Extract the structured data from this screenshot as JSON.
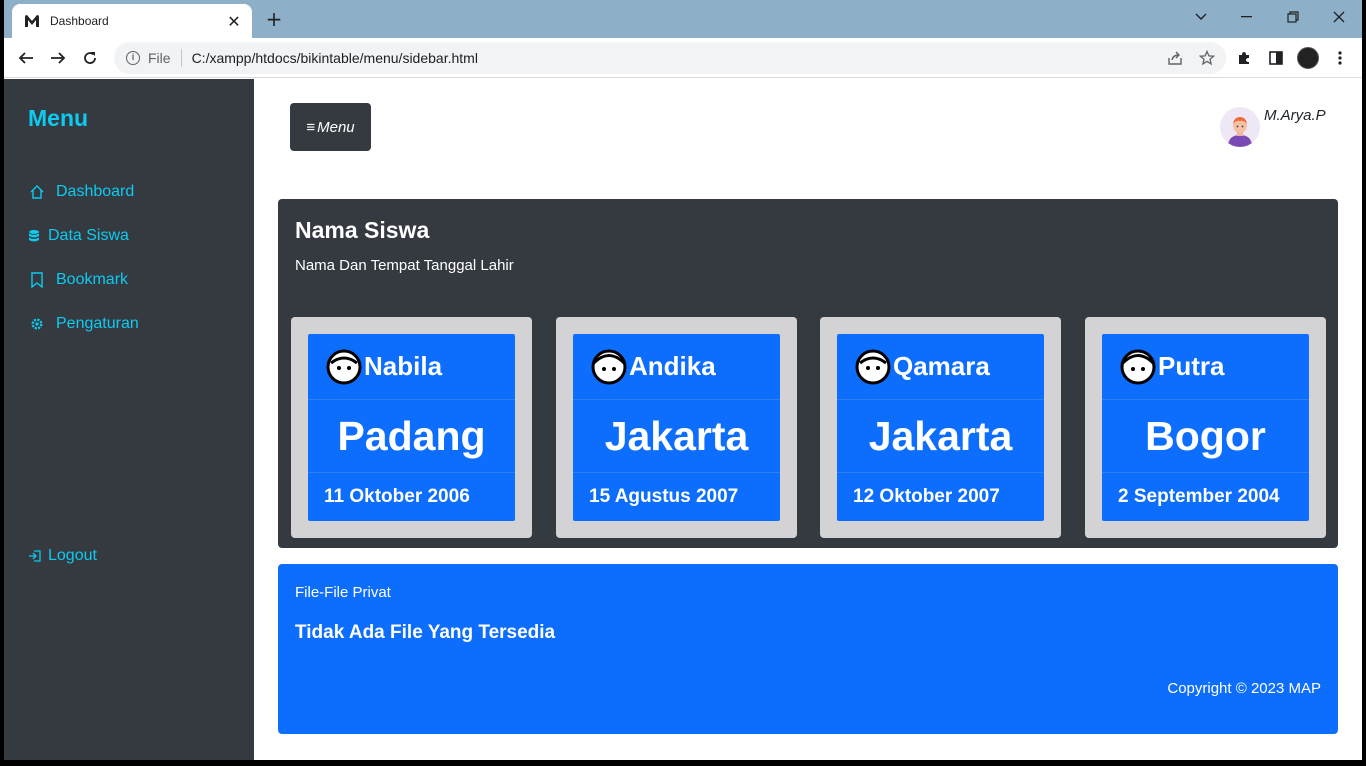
{
  "browser": {
    "tab_title": "Dashboard",
    "scheme": "File",
    "url": "C:/xampp/htdocs/bikintable/menu/sidebar.html"
  },
  "sidebar": {
    "brand": "Menu",
    "items": [
      {
        "label": "Dashboard",
        "icon": "home-icon"
      },
      {
        "label": "Data Siswa",
        "icon": "database-icon"
      },
      {
        "label": "Bookmark",
        "icon": "bookmark-icon"
      },
      {
        "label": "Pengaturan",
        "icon": "gear-icon"
      }
    ],
    "logout": "Logout"
  },
  "header": {
    "menu_button": "Menu",
    "user_name": "M.Arya.P"
  },
  "students_panel": {
    "title": "Nama Siswa",
    "subtitle": "Nama Dan Tempat Tanggal Lahir",
    "students": [
      {
        "name": "Nabila",
        "city": "Padang",
        "date": "11 Oktober 2006"
      },
      {
        "name": "Andika",
        "city": "Jakarta",
        "date": "15 Agustus 2007"
      },
      {
        "name": "Qamara",
        "city": "Jakarta",
        "date": "12 Oktober 2007"
      },
      {
        "name": "Putra",
        "city": "Bogor",
        "date": "2 September 2004"
      }
    ]
  },
  "files_panel": {
    "label": "File-File Privat",
    "message": "Tidak Ada File Yang Tersedia",
    "copyright": "Copyright © 2023 MAP"
  },
  "colors": {
    "sidebar_bg": "#343a40",
    "accent_cyan": "#0dcaf0",
    "primary_blue": "#0d6efd"
  }
}
